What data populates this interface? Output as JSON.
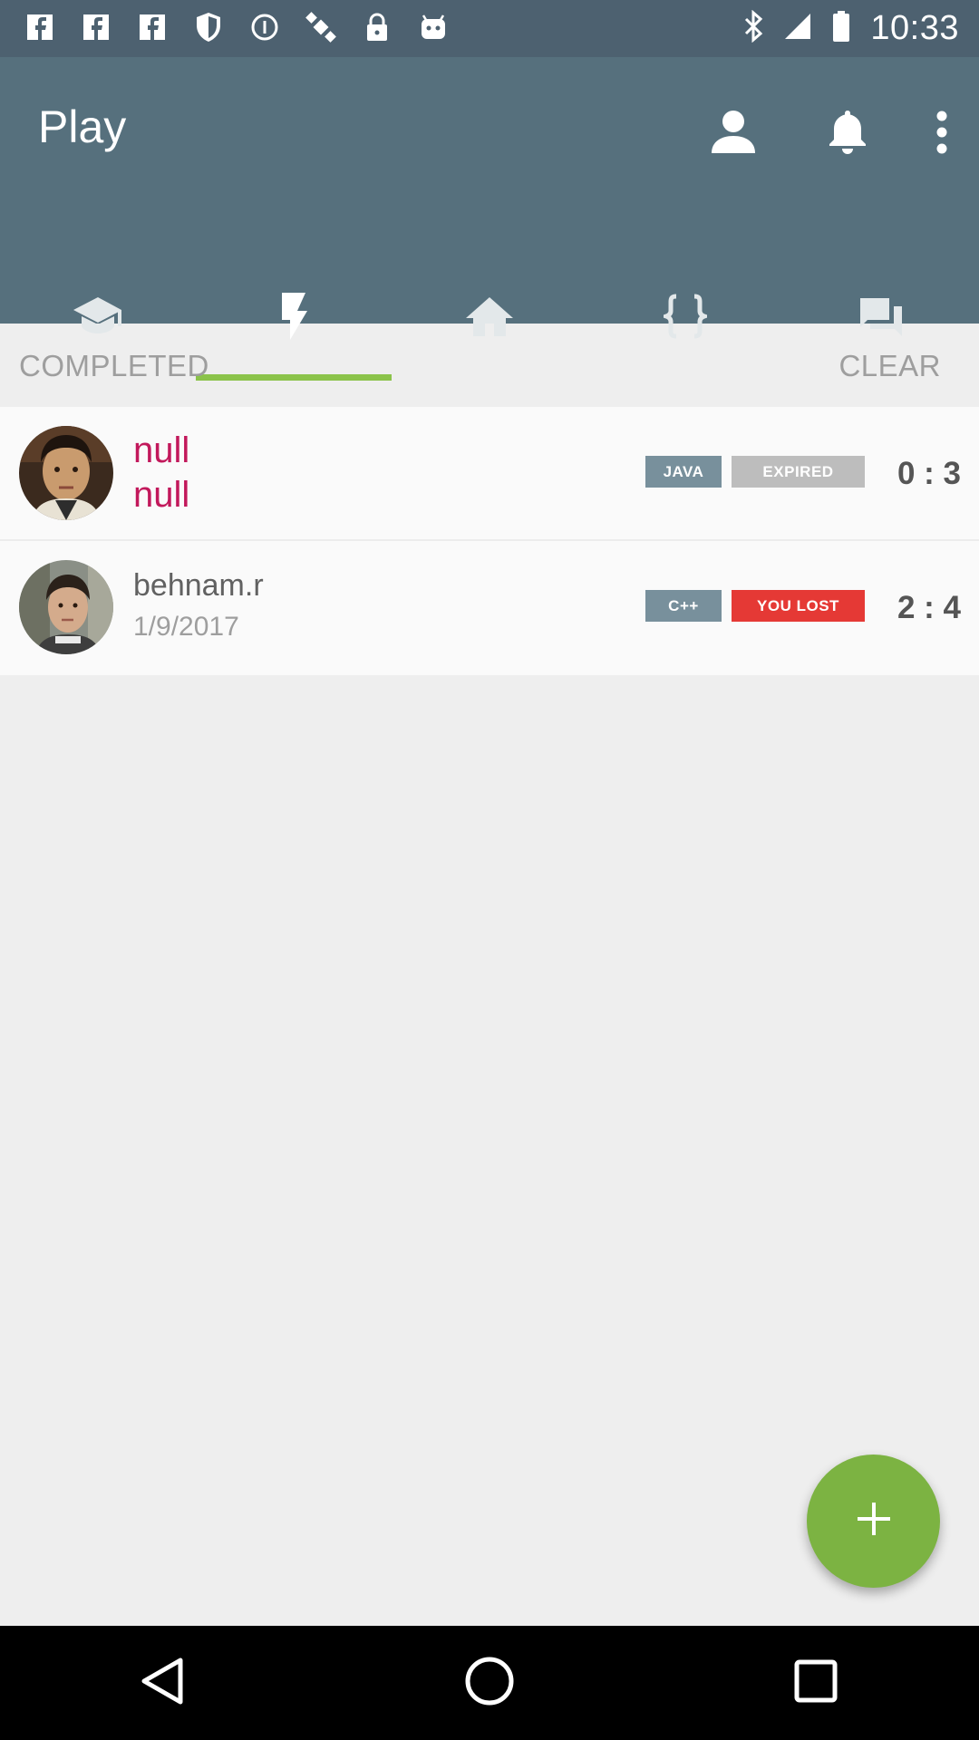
{
  "status_bar": {
    "time": "10:33",
    "left_icons": [
      "facebook-icon",
      "facebook-icon",
      "facebook-icon",
      "shield-icon",
      "info-icon",
      "satellite-icon",
      "lock-icon",
      "android-icon"
    ],
    "right_icons": [
      "bluetooth-icon",
      "signal-icon",
      "battery-icon"
    ]
  },
  "app_bar": {
    "title": "Play",
    "actions": [
      "account-icon",
      "bell-icon",
      "more-vert-icon"
    ]
  },
  "tabs": [
    {
      "icon": "school-icon",
      "selected": false
    },
    {
      "icon": "flash-icon",
      "selected": true
    },
    {
      "icon": "home-icon",
      "selected": false
    },
    {
      "icon": "code-braces-icon",
      "selected": false
    },
    {
      "icon": "forum-icon",
      "selected": false
    }
  ],
  "section": {
    "title": "COMPLETED",
    "clear_label": "CLEAR"
  },
  "games": [
    {
      "line1": "null",
      "line2": "null",
      "language": "JAVA",
      "status": "EXPIRED",
      "score": "0 : 3",
      "colors": {
        "language": "#78909c",
        "status": "#bdbdbd",
        "name": "#c2185b"
      }
    },
    {
      "line1": "behnam.r",
      "line2": "1/9/2017",
      "language": "C++",
      "status": "YOU LOST",
      "score": "2 : 4",
      "colors": {
        "language": "#78909c",
        "status": "#e53935",
        "name": "#616161",
        "date": "#9e9e9e"
      }
    }
  ],
  "colors": {
    "primary": "#56707d",
    "primary_dark": "#4d6170",
    "accent": "#8bc34a",
    "fab": "#7cb342"
  },
  "nav_bar": [
    "back-icon",
    "home-circle-icon",
    "recents-icon"
  ]
}
